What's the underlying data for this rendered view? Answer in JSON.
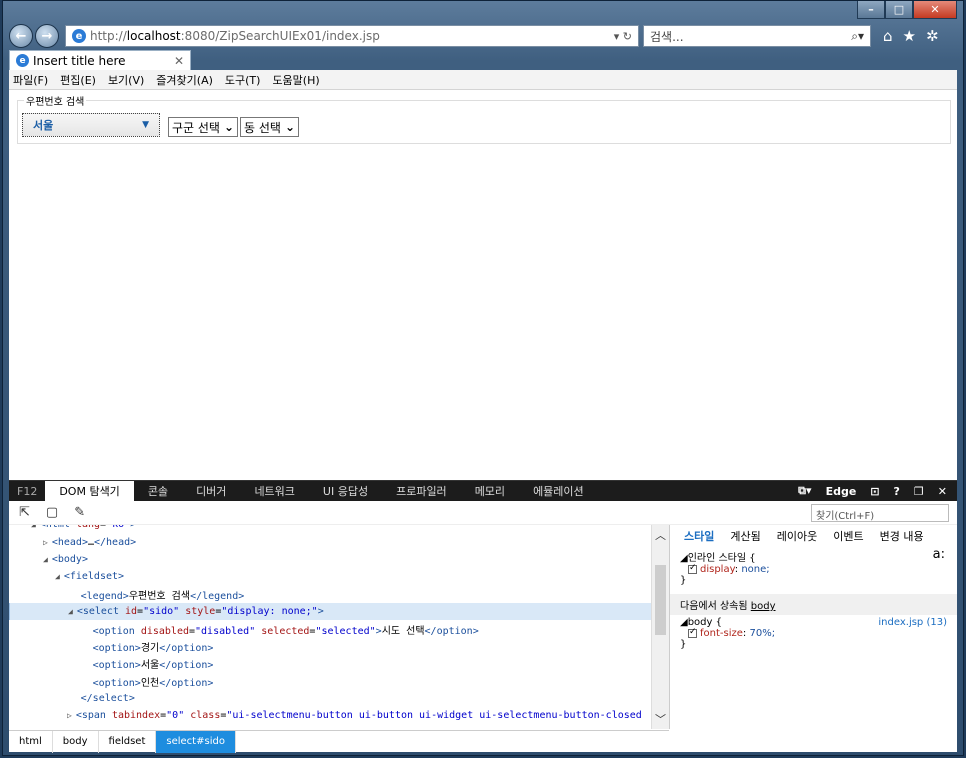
{
  "window": {
    "minimize": "–",
    "maximize": "□",
    "close": "✕"
  },
  "browser": {
    "url_prefix": "http://",
    "url_host": "localhost",
    "url_rest": ":8080/ZipSearchUIEx01/index.jsp",
    "address_tools": "▾ ↻",
    "search_placeholder": "검색...",
    "search_mag": "⌕▾",
    "tab_title": "Insert title here",
    "tab_close": "✕"
  },
  "menu": [
    "파일(F)",
    "편집(E)",
    "보기(V)",
    "즐겨찾기(A)",
    "도구(T)",
    "도움말(H)"
  ],
  "page": {
    "legend": "우편번호 검색",
    "sido_selected": "서울",
    "gugun_select": "구군 선택",
    "dong_select": "동 선택"
  },
  "devtools": {
    "f12": "F12",
    "tabs": [
      "DOM 탐색기",
      "콘솔",
      "디버거",
      "네트워크",
      "UI 응답성",
      "프로파일러",
      "메모리",
      "에뮬레이션"
    ],
    "edge": "Edge",
    "help": "?",
    "find_placeholder": "찾기(Ctrl+F)",
    "dom": [
      {
        "indent": 2,
        "arrow": "◢",
        "html": "<html lang=\"ko\">"
      },
      {
        "indent": 3,
        "arrow": "▷",
        "html": "<head>…</head>"
      },
      {
        "indent": 3,
        "arrow": "◢",
        "html": "<body>"
      },
      {
        "indent": 4,
        "arrow": "◢",
        "html": "<fieldset>"
      },
      {
        "indent": 5,
        "arrow": "",
        "html": "<legend>우편번호 검색</legend>"
      },
      {
        "indent": 5,
        "arrow": "◢",
        "html": "<select id=\"sido\" style=\"display: none;\">"
      },
      {
        "indent": 6,
        "arrow": "",
        "html": "<option disabled=\"disabled\" selected=\"selected\">시도 선택</option>"
      },
      {
        "indent": 6,
        "arrow": "",
        "html": "<option>경기</option>"
      },
      {
        "indent": 6,
        "arrow": "",
        "html": "<option>서울</option>"
      },
      {
        "indent": 6,
        "arrow": "",
        "html": "<option>인천</option>"
      },
      {
        "indent": 5,
        "arrow": "",
        "html": "</select>"
      },
      {
        "indent": 5,
        "arrow": "▷",
        "html": "<span tabindex=\"0\" class=\"ui-selectmenu-button ui-button ui-widget ui-selectmenu-button-closed"
      }
    ],
    "selected_dom_index": 5,
    "style_tabs": [
      "스타일",
      "계산됨",
      "레이아웃",
      "이벤트",
      "변경 내용"
    ],
    "inline_style_title": "◢인라인 스타일  {",
    "inline_prop": "display",
    "inline_val": "none;",
    "close_brace": "}",
    "inherited_prefix": "다음에서 상속됨 ",
    "inherited_from": "body",
    "body_rule": "◢body  {",
    "body_source": "index.jsp (13)",
    "body_prop": "font-size",
    "body_val": "70%;",
    "pseudo": "a:",
    "breadcrumb": [
      "html",
      "body",
      "fieldset",
      "select#sido"
    ]
  }
}
